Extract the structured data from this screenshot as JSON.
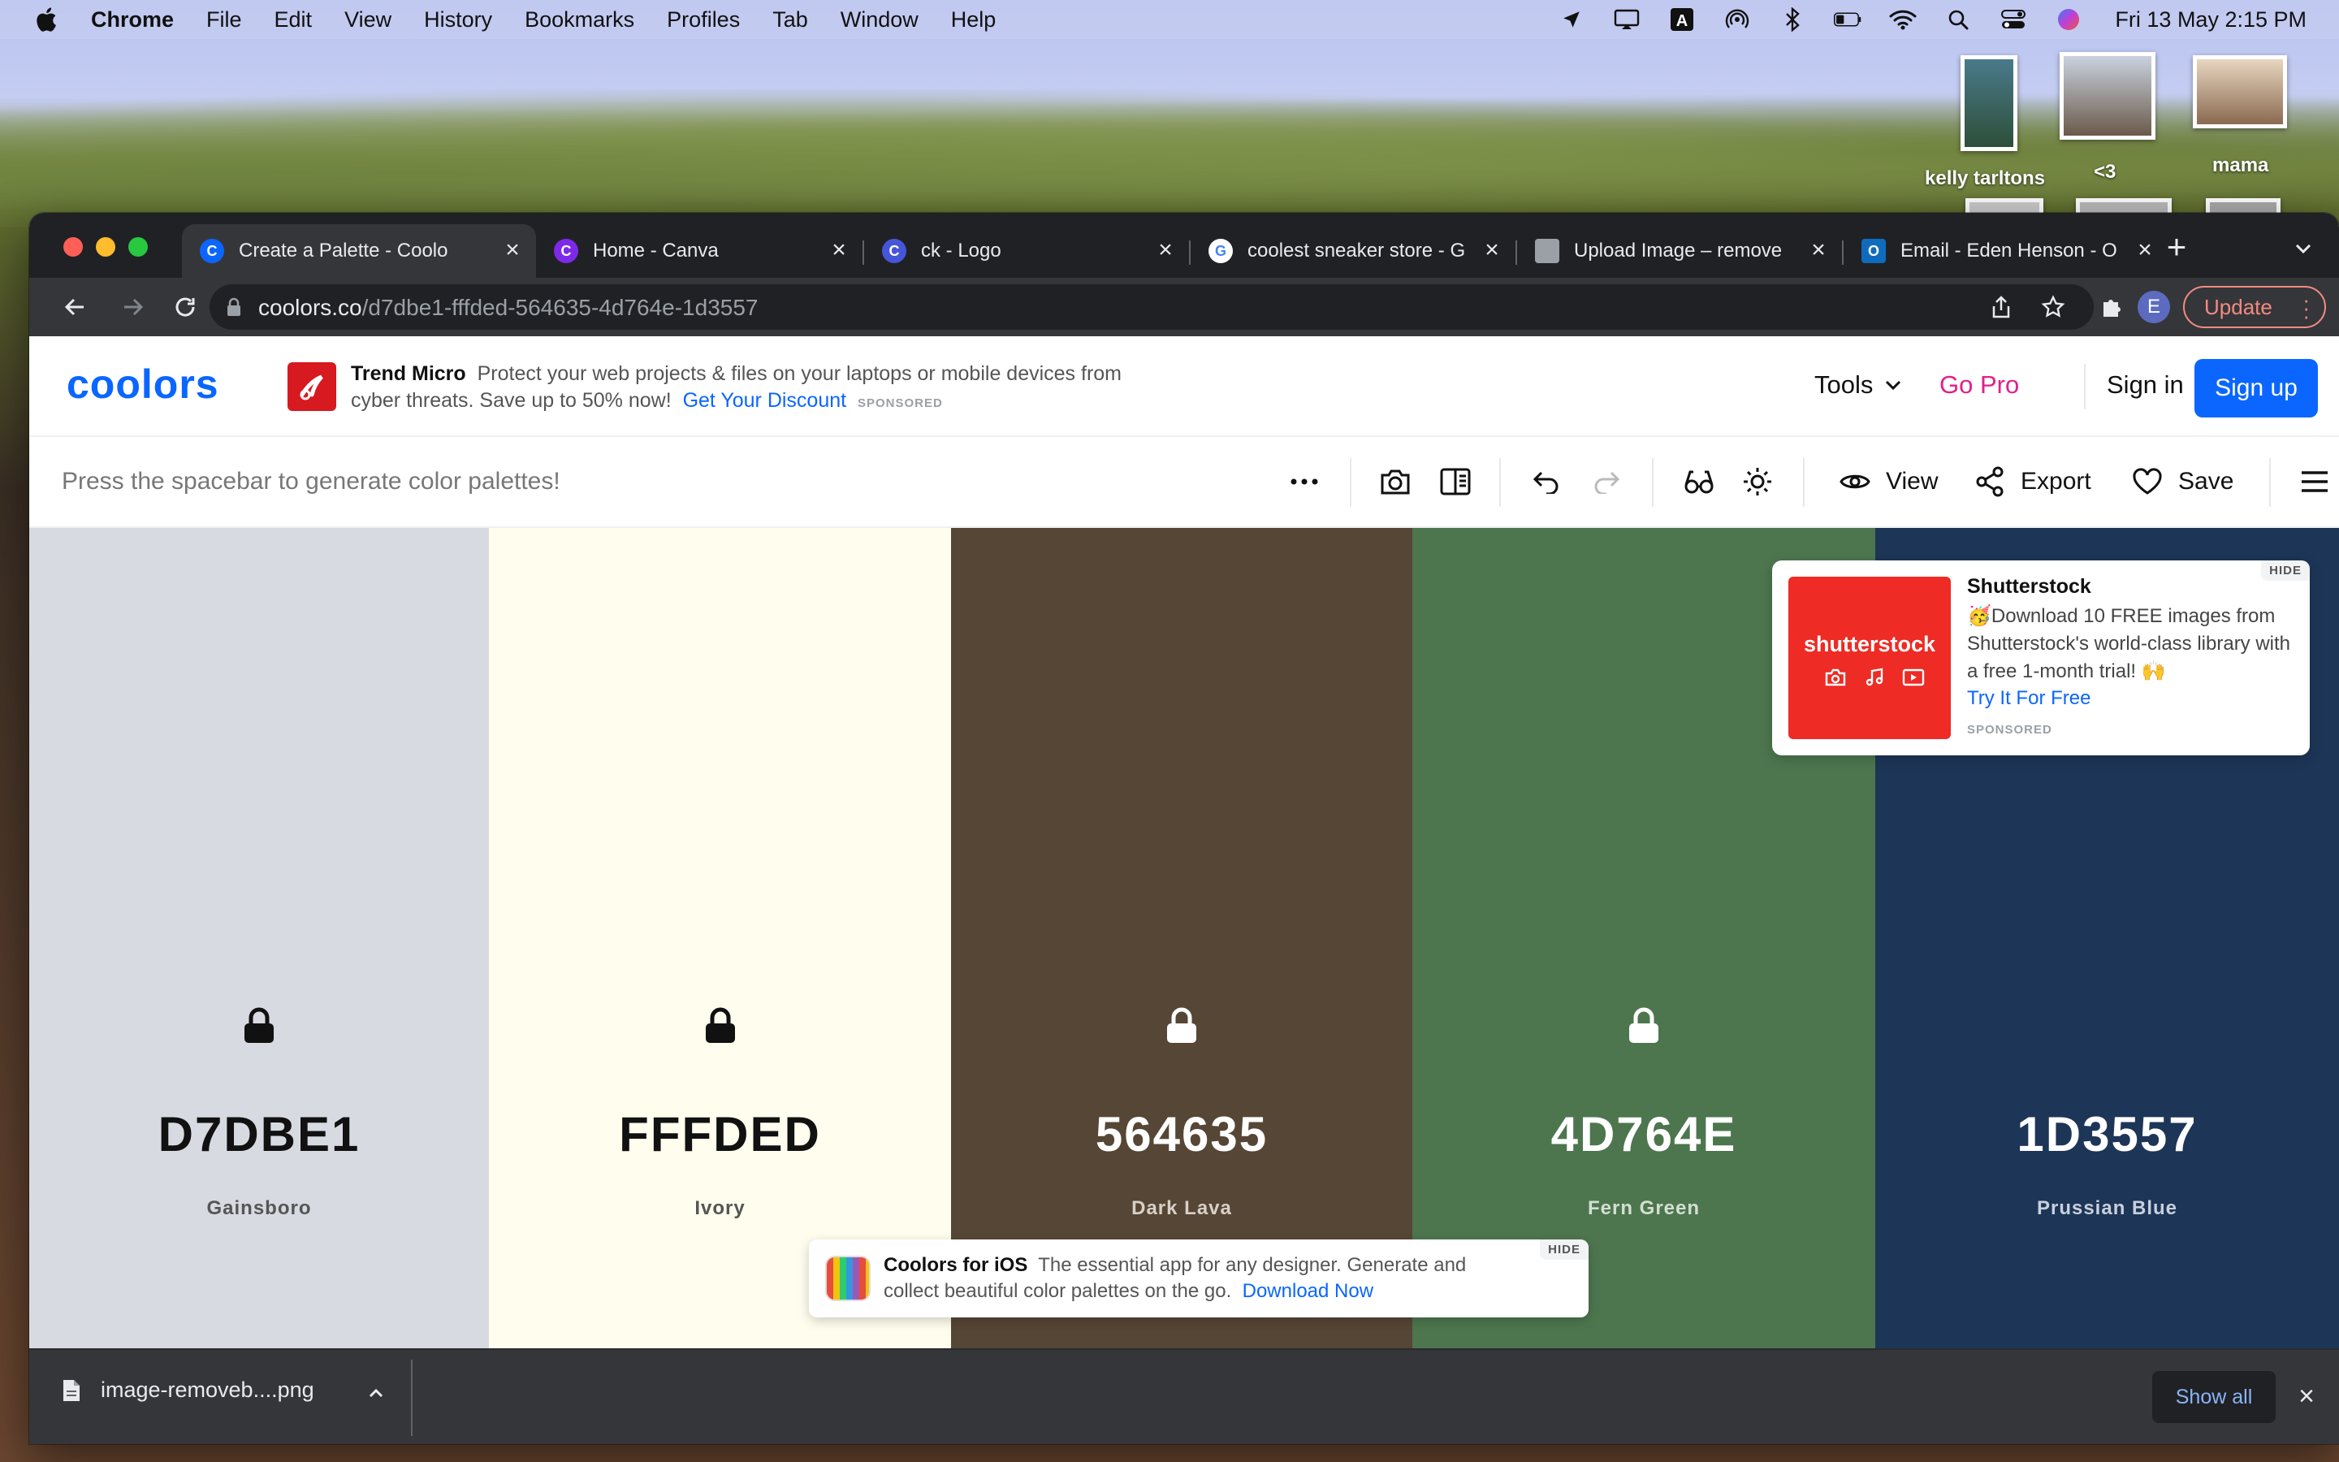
{
  "menubar": {
    "app_name": "Chrome",
    "items": [
      "File",
      "Edit",
      "View",
      "History",
      "Bookmarks",
      "Profiles",
      "Tab",
      "Window",
      "Help"
    ],
    "clock": "Fri 13 May  2:15 PM"
  },
  "desktop": {
    "labels": [
      "kelly tarltons",
      "<3",
      "mama"
    ]
  },
  "browser": {
    "tabs": [
      {
        "title": "Create a Palette - Coolo",
        "favicon": "coolors-icon",
        "active": true
      },
      {
        "title": "Home - Canva",
        "favicon": "canva-icon",
        "active": false
      },
      {
        "title": "ck - Logo",
        "favicon": "canva-icon",
        "active": false
      },
      {
        "title": "coolest sneaker store - G",
        "favicon": "google-icon",
        "active": false
      },
      {
        "title": "Upload Image – remove",
        "favicon": "removebg-icon",
        "active": false
      },
      {
        "title": "Email - Eden Henson - O",
        "favicon": "outlook-icon",
        "active": false
      }
    ],
    "url_domain": "coolors.co",
    "url_path": "/d7dbe1-fffded-564635-4d764e-1d3557",
    "profile_initial": "E",
    "update_label": "Update"
  },
  "site": {
    "logo": "coolors",
    "ad": {
      "brand": "Trend Micro",
      "text": "Protect your web projects & files on your laptops or mobile devices from cyber threats. Save up to 50% now!",
      "cta": "Get Your Discount",
      "sponsored": "SPONSORED"
    },
    "nav": {
      "tools": "Tools",
      "go_pro": "Go Pro",
      "sign_in": "Sign in",
      "sign_up": "Sign up"
    },
    "toolbar": {
      "hint": "Press the spacebar to generate color palettes!",
      "view": "View",
      "export": "Export",
      "save": "Save"
    }
  },
  "palette": {
    "swatches": [
      {
        "hex": "D7DBE1",
        "name": "Gainsboro",
        "bg": "#d7dbe1",
        "fg": "#111111",
        "sub": "#555555"
      },
      {
        "hex": "FFFDED",
        "name": "Ivory",
        "bg": "#fffded",
        "fg": "#111111",
        "sub": "#555555"
      },
      {
        "hex": "564635",
        "name": "Dark Lava",
        "bg": "#564635",
        "fg": "#ffffff",
        "sub": "#d8d0c8"
      },
      {
        "hex": "4D764E",
        "name": "Fern Green",
        "bg": "#4d764e",
        "fg": "#ffffff",
        "sub": "#d3dfd3"
      },
      {
        "hex": "1D3557",
        "name": "Prussian Blue",
        "bg": "#1d3557",
        "fg": "#ffffff",
        "sub": "#c8d0dc"
      }
    ]
  },
  "shutterstock_ad": {
    "logo_text": "shutterstock",
    "title": "Shutterstock",
    "body": "🥳Download 10 FREE images from Shutterstock's world-class library with a free 1-month trial! 🙌",
    "cta": "Try It For Free",
    "sponsored": "SPONSORED",
    "hide": "HIDE"
  },
  "ios_ad": {
    "title": "Coolors for iOS",
    "text": "The essential app for any designer. Generate and collect beautiful color palettes on the go.",
    "cta": "Download Now",
    "hide": "HIDE"
  },
  "downloads": {
    "filename": "image-removeb....png",
    "show_all": "Show all"
  }
}
